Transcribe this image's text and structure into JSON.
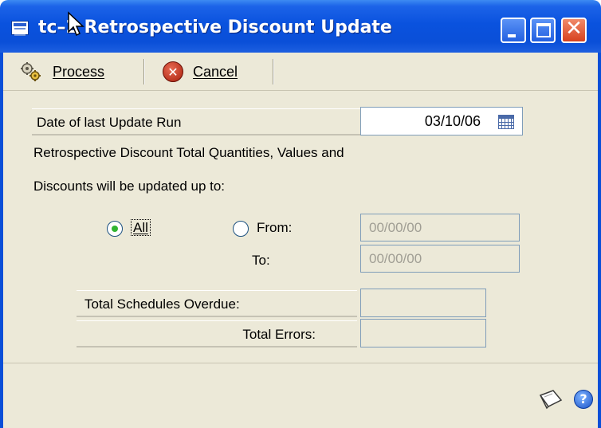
{
  "window": {
    "title": "tc–2 Retrospective Discount Update",
    "controls": {
      "minimize": "minimize",
      "maximize": "maximize",
      "close": "✕"
    }
  },
  "toolbar": {
    "process_label": "Process",
    "cancel_label": "Cancel",
    "process_icon": "gears-icon",
    "cancel_icon": "cancel-circle-icon"
  },
  "form": {
    "last_update_label": "Date of last Update Run",
    "last_update_value": "03/10/06",
    "info_line1": "Retrospective Discount Total Quantities, Values and",
    "info_line2": "Discounts will be updated up to:",
    "range": {
      "all_label": "All",
      "from_label": "From:",
      "to_label": "To:",
      "selected": "All",
      "from_value": "00/00/00",
      "to_value": "00/00/00"
    },
    "summary": {
      "overdue_label": "Total Schedules Overdue:",
      "overdue_value": "",
      "errors_label": "Total Errors:",
      "errors_value": ""
    }
  },
  "footer": {
    "note_icon": "note-icon",
    "help_icon": "help-icon",
    "help_glyph": "?"
  },
  "colors": {
    "titlebar": "#0a52de",
    "panel": "#ece9d8",
    "radio_checked": "#31b431",
    "close_button": "#d7411e"
  }
}
